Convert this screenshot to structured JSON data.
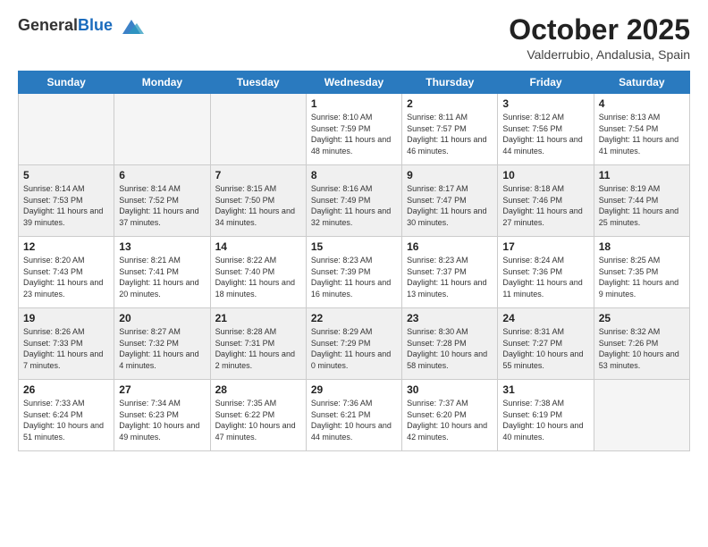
{
  "logo": {
    "general": "General",
    "blue": "Blue"
  },
  "header": {
    "month": "October 2025",
    "location": "Valderrubio, Andalusia, Spain"
  },
  "days_of_week": [
    "Sunday",
    "Monday",
    "Tuesday",
    "Wednesday",
    "Thursday",
    "Friday",
    "Saturday"
  ],
  "weeks": [
    [
      {
        "day": "",
        "info": ""
      },
      {
        "day": "",
        "info": ""
      },
      {
        "day": "",
        "info": ""
      },
      {
        "day": "1",
        "info": "Sunrise: 8:10 AM\nSunset: 7:59 PM\nDaylight: 11 hours and 48 minutes."
      },
      {
        "day": "2",
        "info": "Sunrise: 8:11 AM\nSunset: 7:57 PM\nDaylight: 11 hours and 46 minutes."
      },
      {
        "day": "3",
        "info": "Sunrise: 8:12 AM\nSunset: 7:56 PM\nDaylight: 11 hours and 44 minutes."
      },
      {
        "day": "4",
        "info": "Sunrise: 8:13 AM\nSunset: 7:54 PM\nDaylight: 11 hours and 41 minutes."
      }
    ],
    [
      {
        "day": "5",
        "info": "Sunrise: 8:14 AM\nSunset: 7:53 PM\nDaylight: 11 hours and 39 minutes."
      },
      {
        "day": "6",
        "info": "Sunrise: 8:14 AM\nSunset: 7:52 PM\nDaylight: 11 hours and 37 minutes."
      },
      {
        "day": "7",
        "info": "Sunrise: 8:15 AM\nSunset: 7:50 PM\nDaylight: 11 hours and 34 minutes."
      },
      {
        "day": "8",
        "info": "Sunrise: 8:16 AM\nSunset: 7:49 PM\nDaylight: 11 hours and 32 minutes."
      },
      {
        "day": "9",
        "info": "Sunrise: 8:17 AM\nSunset: 7:47 PM\nDaylight: 11 hours and 30 minutes."
      },
      {
        "day": "10",
        "info": "Sunrise: 8:18 AM\nSunset: 7:46 PM\nDaylight: 11 hours and 27 minutes."
      },
      {
        "day": "11",
        "info": "Sunrise: 8:19 AM\nSunset: 7:44 PM\nDaylight: 11 hours and 25 minutes."
      }
    ],
    [
      {
        "day": "12",
        "info": "Sunrise: 8:20 AM\nSunset: 7:43 PM\nDaylight: 11 hours and 23 minutes."
      },
      {
        "day": "13",
        "info": "Sunrise: 8:21 AM\nSunset: 7:41 PM\nDaylight: 11 hours and 20 minutes."
      },
      {
        "day": "14",
        "info": "Sunrise: 8:22 AM\nSunset: 7:40 PM\nDaylight: 11 hours and 18 minutes."
      },
      {
        "day": "15",
        "info": "Sunrise: 8:23 AM\nSunset: 7:39 PM\nDaylight: 11 hours and 16 minutes."
      },
      {
        "day": "16",
        "info": "Sunrise: 8:23 AM\nSunset: 7:37 PM\nDaylight: 11 hours and 13 minutes."
      },
      {
        "day": "17",
        "info": "Sunrise: 8:24 AM\nSunset: 7:36 PM\nDaylight: 11 hours and 11 minutes."
      },
      {
        "day": "18",
        "info": "Sunrise: 8:25 AM\nSunset: 7:35 PM\nDaylight: 11 hours and 9 minutes."
      }
    ],
    [
      {
        "day": "19",
        "info": "Sunrise: 8:26 AM\nSunset: 7:33 PM\nDaylight: 11 hours and 7 minutes."
      },
      {
        "day": "20",
        "info": "Sunrise: 8:27 AM\nSunset: 7:32 PM\nDaylight: 11 hours and 4 minutes."
      },
      {
        "day": "21",
        "info": "Sunrise: 8:28 AM\nSunset: 7:31 PM\nDaylight: 11 hours and 2 minutes."
      },
      {
        "day": "22",
        "info": "Sunrise: 8:29 AM\nSunset: 7:29 PM\nDaylight: 11 hours and 0 minutes."
      },
      {
        "day": "23",
        "info": "Sunrise: 8:30 AM\nSunset: 7:28 PM\nDaylight: 10 hours and 58 minutes."
      },
      {
        "day": "24",
        "info": "Sunrise: 8:31 AM\nSunset: 7:27 PM\nDaylight: 10 hours and 55 minutes."
      },
      {
        "day": "25",
        "info": "Sunrise: 8:32 AM\nSunset: 7:26 PM\nDaylight: 10 hours and 53 minutes."
      }
    ],
    [
      {
        "day": "26",
        "info": "Sunrise: 7:33 AM\nSunset: 6:24 PM\nDaylight: 10 hours and 51 minutes."
      },
      {
        "day": "27",
        "info": "Sunrise: 7:34 AM\nSunset: 6:23 PM\nDaylight: 10 hours and 49 minutes."
      },
      {
        "day": "28",
        "info": "Sunrise: 7:35 AM\nSunset: 6:22 PM\nDaylight: 10 hours and 47 minutes."
      },
      {
        "day": "29",
        "info": "Sunrise: 7:36 AM\nSunset: 6:21 PM\nDaylight: 10 hours and 44 minutes."
      },
      {
        "day": "30",
        "info": "Sunrise: 7:37 AM\nSunset: 6:20 PM\nDaylight: 10 hours and 42 minutes."
      },
      {
        "day": "31",
        "info": "Sunrise: 7:38 AM\nSunset: 6:19 PM\nDaylight: 10 hours and 40 minutes."
      },
      {
        "day": "",
        "info": ""
      }
    ]
  ]
}
